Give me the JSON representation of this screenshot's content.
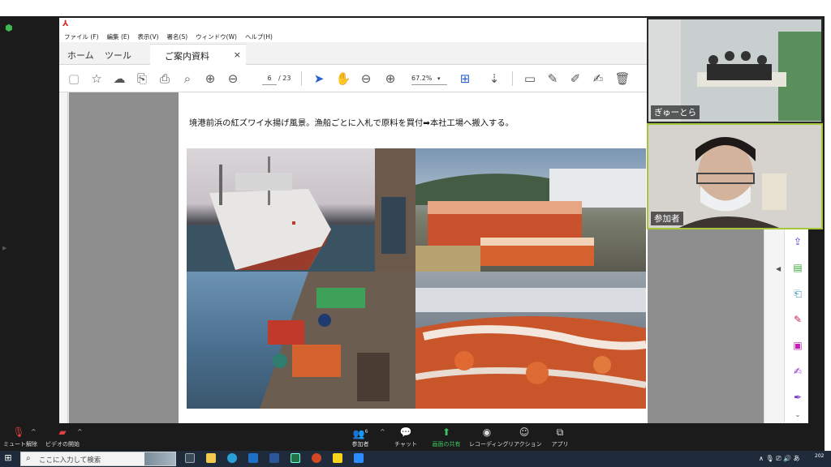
{
  "pdf_viewer": {
    "menu": [
      "ファイル (F)",
      "編集 (E)",
      "表示(V)",
      "署名(S)",
      "ウィンドウ(W)",
      "ヘルプ(H)"
    ],
    "tabs": {
      "home": "ホーム",
      "tools": "ツール",
      "document": "ご案内資料",
      "close": "×"
    },
    "page_current": "6",
    "page_total": "/ 23",
    "zoom": "67.2%",
    "caption": "境港前浜の紅ズワイ水揚げ風景。漁船ごとに入札で原料を買付➡本社工場へ搬入する。"
  },
  "participants": [
    {
      "name": "ぎゅーとら"
    },
    {
      "name": "参加者"
    }
  ],
  "zoom_controls": {
    "mute": "ミュート解除",
    "video": "ビデオの開始",
    "participants": "参加者",
    "participants_count": "6",
    "chat": "チャット",
    "share": "画面の共有",
    "record": "レコーディング",
    "reactions": "リアクション",
    "apps": "アプリ"
  },
  "taskbar": {
    "search_placeholder": "ここに入力して検索",
    "tray_ime": "あ",
    "clock": "202"
  },
  "colors": {
    "share_green": "#3cc85f",
    "accent_blue": "#2b62c9",
    "pdf_red": "#d32f2f",
    "right_tool_pink": "#c41fb4",
    "right_tool_green": "#3da83d"
  }
}
